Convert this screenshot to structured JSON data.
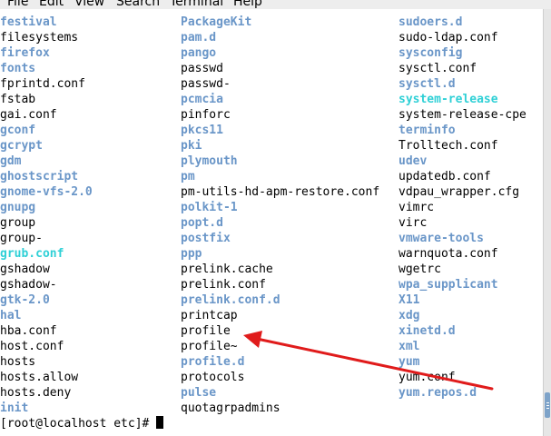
{
  "menu": [
    "File",
    "Edit",
    "View",
    "Search",
    "Terminal",
    "Help"
  ],
  "columns": [
    [
      {
        "name": "festival",
        "kind": "dir"
      },
      {
        "name": "filesystems",
        "kind": "file"
      },
      {
        "name": "firefox",
        "kind": "dir"
      },
      {
        "name": "fonts",
        "kind": "dir"
      },
      {
        "name": "fprintd.conf",
        "kind": "file"
      },
      {
        "name": "fstab",
        "kind": "file"
      },
      {
        "name": "gai.conf",
        "kind": "file"
      },
      {
        "name": "gconf",
        "kind": "dir"
      },
      {
        "name": "gcrypt",
        "kind": "dir"
      },
      {
        "name": "gdm",
        "kind": "dir"
      },
      {
        "name": "ghostscript",
        "kind": "dir"
      },
      {
        "name": "gnome-vfs-2.0",
        "kind": "dir"
      },
      {
        "name": "gnupg",
        "kind": "dir"
      },
      {
        "name": "group",
        "kind": "file"
      },
      {
        "name": "group-",
        "kind": "file"
      },
      {
        "name": "grub.conf",
        "kind": "link"
      },
      {
        "name": "gshadow",
        "kind": "file"
      },
      {
        "name": "gshadow-",
        "kind": "file"
      },
      {
        "name": "gtk-2.0",
        "kind": "dir"
      },
      {
        "name": "hal",
        "kind": "dir"
      },
      {
        "name": "hba.conf",
        "kind": "file"
      },
      {
        "name": "host.conf",
        "kind": "file"
      },
      {
        "name": "hosts",
        "kind": "file"
      },
      {
        "name": "hosts.allow",
        "kind": "file"
      },
      {
        "name": "hosts.deny",
        "kind": "file"
      },
      {
        "name": "init",
        "kind": "dir"
      }
    ],
    [
      {
        "name": "PackageKit",
        "kind": "dir"
      },
      {
        "name": "pam.d",
        "kind": "dir"
      },
      {
        "name": "pango",
        "kind": "dir"
      },
      {
        "name": "passwd",
        "kind": "file"
      },
      {
        "name": "passwd-",
        "kind": "file"
      },
      {
        "name": "pcmcia",
        "kind": "dir"
      },
      {
        "name": "pinforc",
        "kind": "file"
      },
      {
        "name": "pkcs11",
        "kind": "dir"
      },
      {
        "name": "pki",
        "kind": "dir"
      },
      {
        "name": "plymouth",
        "kind": "dir"
      },
      {
        "name": "pm",
        "kind": "dir"
      },
      {
        "name": "pm-utils-hd-apm-restore.conf",
        "kind": "file"
      },
      {
        "name": "polkit-1",
        "kind": "dir"
      },
      {
        "name": "popt.d",
        "kind": "dir"
      },
      {
        "name": "postfix",
        "kind": "dir"
      },
      {
        "name": "ppp",
        "kind": "dir"
      },
      {
        "name": "prelink.cache",
        "kind": "file"
      },
      {
        "name": "prelink.conf",
        "kind": "file"
      },
      {
        "name": "prelink.conf.d",
        "kind": "dir"
      },
      {
        "name": "printcap",
        "kind": "file"
      },
      {
        "name": "profile",
        "kind": "file"
      },
      {
        "name": "profile~",
        "kind": "file"
      },
      {
        "name": "profile.d",
        "kind": "dir"
      },
      {
        "name": "protocols",
        "kind": "file"
      },
      {
        "name": "pulse",
        "kind": "dir"
      },
      {
        "name": "quotagrpadmins",
        "kind": "file"
      }
    ],
    [
      {
        "name": "sudoers.d",
        "kind": "dir"
      },
      {
        "name": "sudo-ldap.conf",
        "kind": "file"
      },
      {
        "name": "sysconfig",
        "kind": "dir"
      },
      {
        "name": "sysctl.conf",
        "kind": "file"
      },
      {
        "name": "sysctl.d",
        "kind": "dir"
      },
      {
        "name": "system-release",
        "kind": "link"
      },
      {
        "name": "system-release-cpe",
        "kind": "file"
      },
      {
        "name": "terminfo",
        "kind": "dir"
      },
      {
        "name": "Trolltech.conf",
        "kind": "file"
      },
      {
        "name": "udev",
        "kind": "dir"
      },
      {
        "name": "updatedb.conf",
        "kind": "file"
      },
      {
        "name": "vdpau_wrapper.cfg",
        "kind": "file"
      },
      {
        "name": "vimrc",
        "kind": "file"
      },
      {
        "name": "virc",
        "kind": "file"
      },
      {
        "name": "vmware-tools",
        "kind": "dir"
      },
      {
        "name": "warnquota.conf",
        "kind": "file"
      },
      {
        "name": "wgetrc",
        "kind": "file"
      },
      {
        "name": "wpa_supplicant",
        "kind": "dir"
      },
      {
        "name": "X11",
        "kind": "dir"
      },
      {
        "name": "xdg",
        "kind": "dir"
      },
      {
        "name": "xinetd.d",
        "kind": "dir"
      },
      {
        "name": "xml",
        "kind": "dir"
      },
      {
        "name": "yum",
        "kind": "dir"
      },
      {
        "name": "yum.conf",
        "kind": "file"
      },
      {
        "name": "yum.repos.d",
        "kind": "dir"
      }
    ]
  ],
  "prompt": "[root@localhost etc]# ",
  "colors": {
    "directory": "#6a96c8",
    "symlink": "#2fd0d6",
    "arrow": "#e01b1b"
  },
  "annotation": {
    "icon": "red-arrow-icon",
    "target": "profile"
  }
}
